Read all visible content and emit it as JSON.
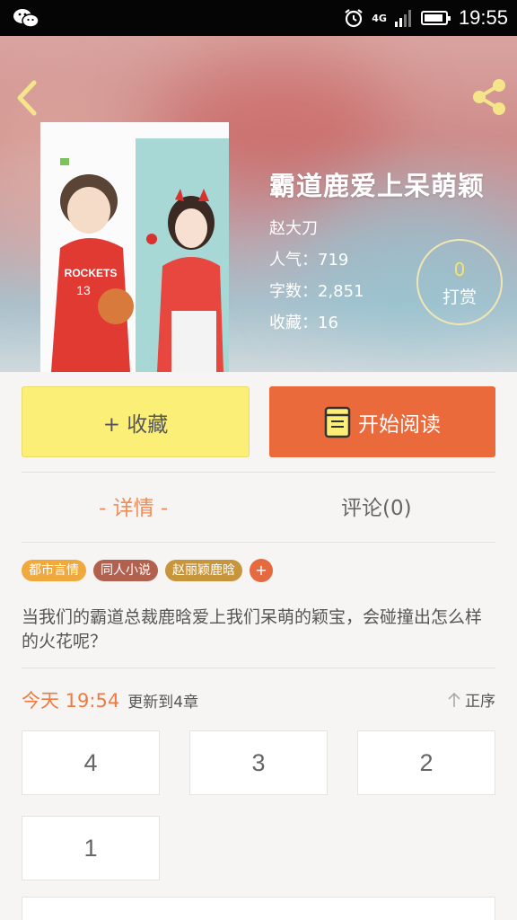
{
  "status_bar": {
    "time": "19:55",
    "network": "4G",
    "left_icon": "wechat-icon",
    "right_icons": [
      "alarm-icon",
      "signal-icon",
      "battery-icon"
    ]
  },
  "header": {
    "back_icon": "back-arrow-icon",
    "share_icon": "share-icon"
  },
  "book": {
    "title": "霸道鹿爱上呆萌颖",
    "author": "赵大刀",
    "popularity": "人气：719",
    "word_count": "字数：2,851",
    "favorites": "收藏：16",
    "cover_jersey_text": "ROCKETS",
    "cover_jersey_number": "13"
  },
  "reward": {
    "count": "0",
    "label": "打赏"
  },
  "actions": {
    "collect_label": "+ 收藏",
    "read_label": "开始阅读"
  },
  "tabs": {
    "detail": "- 详情 -",
    "comment": "评论(0)"
  },
  "tags": [
    {
      "label": "都市言情",
      "color": "#f0a93c"
    },
    {
      "label": "同人小说",
      "color": "#b2614f"
    },
    {
      "label": "赵丽颖鹿晗",
      "color": "#c7953b"
    }
  ],
  "tag_add": "+",
  "description": "当我们的霸道总裁鹿晗爱上我们呆萌的颖宝，会碰撞出怎么样的火花呢？",
  "update": {
    "time": "今天 19:54",
    "text": "更新到4章",
    "sort_label": "正序"
  },
  "chapters": [
    "4",
    "3",
    "2",
    "1"
  ],
  "colors": {
    "accent_orange": "#ea6a3b",
    "collect_yellow": "#fcef78",
    "tab_active": "#ef8c58"
  }
}
